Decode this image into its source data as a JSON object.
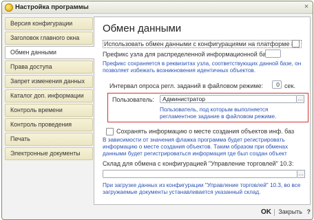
{
  "window": {
    "title": "Настройка программы",
    "close_icon": "close-icon"
  },
  "sidebar": {
    "items": [
      {
        "label": "Версия конфигурации",
        "active": false
      },
      {
        "label": "Заголовок главного окна",
        "active": false
      },
      {
        "label": "Обмен данными",
        "active": true
      },
      {
        "label": "Права доступа",
        "active": false
      },
      {
        "label": "Запрет изменения данных",
        "active": false
      },
      {
        "label": "Каталог доп. информации",
        "active": false
      },
      {
        "label": "Контроль времени",
        "active": false
      },
      {
        "label": "Контроль проведения",
        "active": false
      },
      {
        "label": "Печать",
        "active": false
      },
      {
        "label": "Электронные документы",
        "active": false
      }
    ]
  },
  "main": {
    "heading": "Обмен данными",
    "use_exchange_label": "Использовать обмен данными с конфигурациями на платформе 8.2",
    "use_exchange_checked": false,
    "prefix_label": "Префикс узла для распределенной информационной базы:",
    "prefix_value": "",
    "prefix_note": "Префикс сохраняется в реквизитах узла, соответствующих данной базе, он позволяет избежать возникновения идентичных объектов.",
    "interval_label": "Интервал опроса регл. заданий в файловом режиме:",
    "interval_value": "0",
    "interval_unit": "сек.",
    "user_label": "Пользователь:",
    "user_value": "Администратор",
    "user_note": "Пользователь, под которым выполняется регламентное задание в файловом режиме.",
    "save_place_label": "Сохранять информацию о месте создания объектов инф. баз",
    "save_place_checked": false,
    "save_place_note": "В зависимости от значения флажка программа будет регистрировать информацию о месте создания объектов. Таким образом при обменах данными будет регистрироваться информация где был создан объект",
    "warehouse_label": "Склад для обмена с конфигурацией \"Управление торговлей\" 10.3:",
    "warehouse_value": "",
    "warehouse_note": "При загрузке данных из конфигурации \"Управление торговлей\" 10.3, во все загружаемые документы устанавливается указанный склад."
  },
  "footer": {
    "ok_label": "OK",
    "close_label": "Закрыть",
    "help_label": "?"
  },
  "colors": {
    "note_text": "#2a51b4",
    "highlight_border": "#d53030",
    "tab_bg": "#ece6c4"
  }
}
